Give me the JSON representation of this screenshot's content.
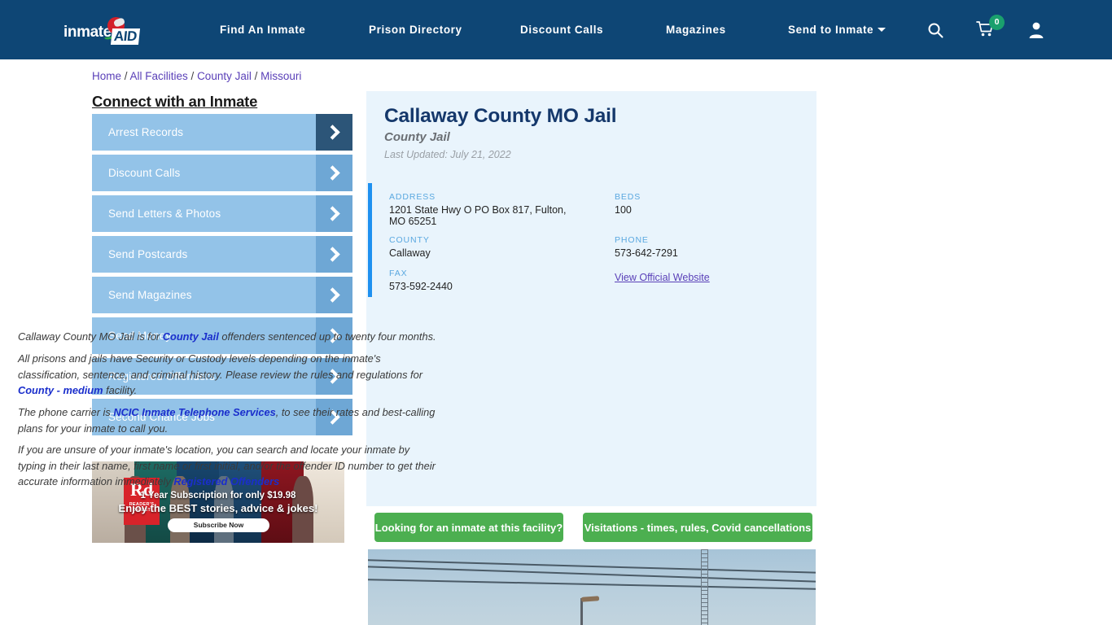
{
  "header": {
    "brand": {
      "text": "inmate",
      "badge": "AID",
      "logo_icon": "inmateaid-logo"
    },
    "nav": [
      {
        "label": "Find An Inmate",
        "name": "nav-find-an-inmate"
      },
      {
        "label": "Prison Directory",
        "name": "nav-prison-directory"
      },
      {
        "label": "Discount Calls",
        "name": "nav-discount-calls"
      },
      {
        "label": "Magazines",
        "name": "nav-magazines"
      },
      {
        "label": "Send to Inmate",
        "name": "nav-send-to-inmate",
        "has_caret": true
      }
    ],
    "icons": {
      "search": "search-icon",
      "cart": "shopping-cart-icon",
      "cart_count": "0",
      "account": "user-account-icon"
    },
    "background_color": "#0e4675",
    "cart_badge_color": "#1aa06d"
  },
  "breadcrumb": {
    "items": [
      "Home",
      "All Facilities",
      "County Jail",
      "Missouri"
    ],
    "separator": "/",
    "link_color": "#5a40b8"
  },
  "sidebar": {
    "title": "Connect with an Inmate",
    "items": [
      {
        "label": "Arrest Records",
        "active": true
      },
      {
        "label": "Discount Calls",
        "active": false
      },
      {
        "label": "Send Letters & Photos",
        "active": false
      },
      {
        "label": "Send Postcards",
        "active": false
      },
      {
        "label": "Send Magazines",
        "active": false
      },
      {
        "label": "Send Money",
        "active": false
      },
      {
        "label": "Registered Offenders",
        "active": false
      },
      {
        "label": "Second Chance Jobs",
        "active": false
      }
    ],
    "button_color": "#93c3e8",
    "chevron_box_color": "#6ea7d5",
    "chevron_box_active_color": "#2c5578"
  },
  "ad": {
    "brand_initials": "Rd",
    "brand_sub": "READER'S DIGEST",
    "line1": "1 Year Subscription for only $19.98",
    "line2": "Enjoy the BEST stories, advice & jokes!",
    "cta": "Subscribe Now"
  },
  "facility": {
    "title": "Callaway County MO Jail",
    "subtitle": "County Jail",
    "last_updated": "Last Updated: July 21, 2022",
    "info": {
      "address_label": "ADDRESS",
      "address_value": "1201 State Hwy O PO Box 817, Fulton, MO 65251",
      "beds_label": "BEDS",
      "beds_value": "100",
      "county_label": "COUNTY",
      "county_value": "Callaway",
      "phone_label": "PHONE",
      "phone_value": "573-642-7291",
      "fax_label": "FAX",
      "fax_value": "573-592-2440",
      "official_website_link": "View Official Website"
    },
    "accent_color": "#1e90f0",
    "panel_color": "#e9f4fc"
  },
  "body": {
    "para1_pre": "Callaway County MO Jail is for ",
    "para1_link": "County Jail",
    "para1_post": " offenders sentenced up to twenty four months.",
    "para2_pre": "All prisons and jails have Security or Custody levels depending on the inmate's classification, sentence, and criminal history. Please review the rules and regulations for ",
    "para2_link": "County - medium",
    "para2_post": " facility.",
    "para3_pre": "The phone carrier is ",
    "para3_link": "NCIC Inmate Telephone Services",
    "para3_post": ", to see their rates and best-calling plans for your inmate to call you.",
    "para4_pre": "If you are unsure of your inmate's location, you can search and locate your inmate by typing in their last name, first name or first initial, and/or the offender ID number to get their accurate information immediately ",
    "para4_link": "Registered Offenders",
    "para4_post": ""
  },
  "actions": {
    "looking_label": "Looking for an inmate at this facility?",
    "visitations_label": "Visitations - times, rules, Covid cancellations",
    "button_color": "#4caf50"
  },
  "photo": {
    "alt": "facility-exterior-photo-sky-power-lines"
  }
}
